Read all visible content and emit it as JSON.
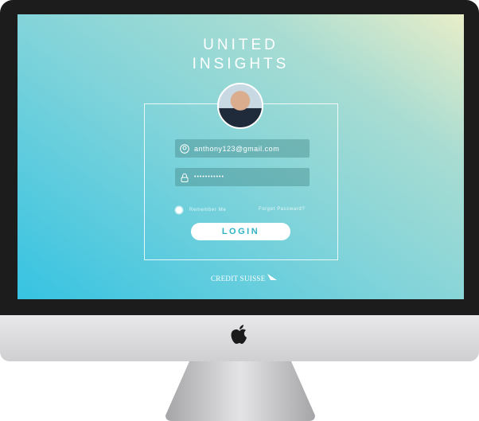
{
  "app": {
    "title_line1": "UNITED",
    "title_line2": "INSIGHTS"
  },
  "login_form": {
    "email_value": "anthony123@gmail.com",
    "password_value": "•••••••••••",
    "remember_label": "Remember Me",
    "forgot_label": "Forget Passward?",
    "login_label": "LOGIN"
  },
  "footer": {
    "brand": "CREDIT SUISSE"
  },
  "icons": {
    "email": "user-circle-icon",
    "password": "lock-icon",
    "brand": "sails-icon",
    "device": "apple-logo-icon"
  },
  "colors": {
    "accent": "#2fb3c4",
    "gradient_start": "#36c3e2",
    "gradient_end": "#e8edc8"
  }
}
